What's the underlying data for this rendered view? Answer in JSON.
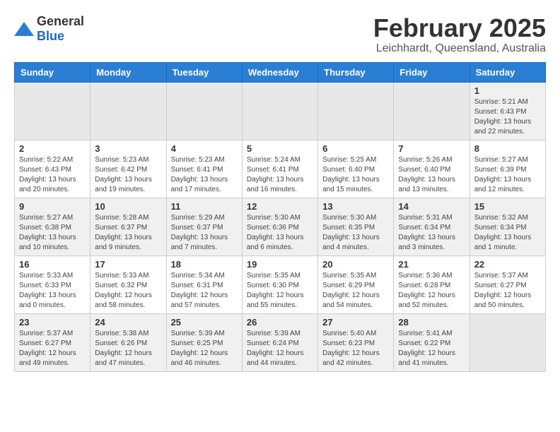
{
  "logo": {
    "text_general": "General",
    "text_blue": "Blue"
  },
  "header": {
    "title": "February 2025",
    "subtitle": "Leichhardt, Queensland, Australia"
  },
  "weekdays": [
    "Sunday",
    "Monday",
    "Tuesday",
    "Wednesday",
    "Thursday",
    "Friday",
    "Saturday"
  ],
  "weeks": [
    [
      {
        "day": "",
        "info": ""
      },
      {
        "day": "",
        "info": ""
      },
      {
        "day": "",
        "info": ""
      },
      {
        "day": "",
        "info": ""
      },
      {
        "day": "",
        "info": ""
      },
      {
        "day": "",
        "info": ""
      },
      {
        "day": "1",
        "info": "Sunrise: 5:21 AM\nSunset: 6:43 PM\nDaylight: 13 hours and 22 minutes."
      }
    ],
    [
      {
        "day": "2",
        "info": "Sunrise: 5:22 AM\nSunset: 6:43 PM\nDaylight: 13 hours and 20 minutes."
      },
      {
        "day": "3",
        "info": "Sunrise: 5:23 AM\nSunset: 6:42 PM\nDaylight: 13 hours and 19 minutes."
      },
      {
        "day": "4",
        "info": "Sunrise: 5:23 AM\nSunset: 6:41 PM\nDaylight: 13 hours and 17 minutes."
      },
      {
        "day": "5",
        "info": "Sunrise: 5:24 AM\nSunset: 6:41 PM\nDaylight: 13 hours and 16 minutes."
      },
      {
        "day": "6",
        "info": "Sunrise: 5:25 AM\nSunset: 6:40 PM\nDaylight: 13 hours and 15 minutes."
      },
      {
        "day": "7",
        "info": "Sunrise: 5:26 AM\nSunset: 6:40 PM\nDaylight: 13 hours and 13 minutes."
      },
      {
        "day": "8",
        "info": "Sunrise: 5:27 AM\nSunset: 6:39 PM\nDaylight: 13 hours and 12 minutes."
      }
    ],
    [
      {
        "day": "9",
        "info": "Sunrise: 5:27 AM\nSunset: 6:38 PM\nDaylight: 13 hours and 10 minutes."
      },
      {
        "day": "10",
        "info": "Sunrise: 5:28 AM\nSunset: 6:37 PM\nDaylight: 13 hours and 9 minutes."
      },
      {
        "day": "11",
        "info": "Sunrise: 5:29 AM\nSunset: 6:37 PM\nDaylight: 13 hours and 7 minutes."
      },
      {
        "day": "12",
        "info": "Sunrise: 5:30 AM\nSunset: 6:36 PM\nDaylight: 13 hours and 6 minutes."
      },
      {
        "day": "13",
        "info": "Sunrise: 5:30 AM\nSunset: 6:35 PM\nDaylight: 13 hours and 4 minutes."
      },
      {
        "day": "14",
        "info": "Sunrise: 5:31 AM\nSunset: 6:34 PM\nDaylight: 13 hours and 3 minutes."
      },
      {
        "day": "15",
        "info": "Sunrise: 5:32 AM\nSunset: 6:34 PM\nDaylight: 13 hours and 1 minute."
      }
    ],
    [
      {
        "day": "16",
        "info": "Sunrise: 5:33 AM\nSunset: 6:33 PM\nDaylight: 13 hours and 0 minutes."
      },
      {
        "day": "17",
        "info": "Sunrise: 5:33 AM\nSunset: 6:32 PM\nDaylight: 12 hours and 58 minutes."
      },
      {
        "day": "18",
        "info": "Sunrise: 5:34 AM\nSunset: 6:31 PM\nDaylight: 12 hours and 57 minutes."
      },
      {
        "day": "19",
        "info": "Sunrise: 5:35 AM\nSunset: 6:30 PM\nDaylight: 12 hours and 55 minutes."
      },
      {
        "day": "20",
        "info": "Sunrise: 5:35 AM\nSunset: 6:29 PM\nDaylight: 12 hours and 54 minutes."
      },
      {
        "day": "21",
        "info": "Sunrise: 5:36 AM\nSunset: 6:28 PM\nDaylight: 12 hours and 52 minutes."
      },
      {
        "day": "22",
        "info": "Sunrise: 5:37 AM\nSunset: 6:27 PM\nDaylight: 12 hours and 50 minutes."
      }
    ],
    [
      {
        "day": "23",
        "info": "Sunrise: 5:37 AM\nSunset: 6:27 PM\nDaylight: 12 hours and 49 minutes."
      },
      {
        "day": "24",
        "info": "Sunrise: 5:38 AM\nSunset: 6:26 PM\nDaylight: 12 hours and 47 minutes."
      },
      {
        "day": "25",
        "info": "Sunrise: 5:39 AM\nSunset: 6:25 PM\nDaylight: 12 hours and 46 minutes."
      },
      {
        "day": "26",
        "info": "Sunrise: 5:39 AM\nSunset: 6:24 PM\nDaylight: 12 hours and 44 minutes."
      },
      {
        "day": "27",
        "info": "Sunrise: 5:40 AM\nSunset: 6:23 PM\nDaylight: 12 hours and 42 minutes."
      },
      {
        "day": "28",
        "info": "Sunrise: 5:41 AM\nSunset: 6:22 PM\nDaylight: 12 hours and 41 minutes."
      },
      {
        "day": "",
        "info": ""
      }
    ]
  ]
}
